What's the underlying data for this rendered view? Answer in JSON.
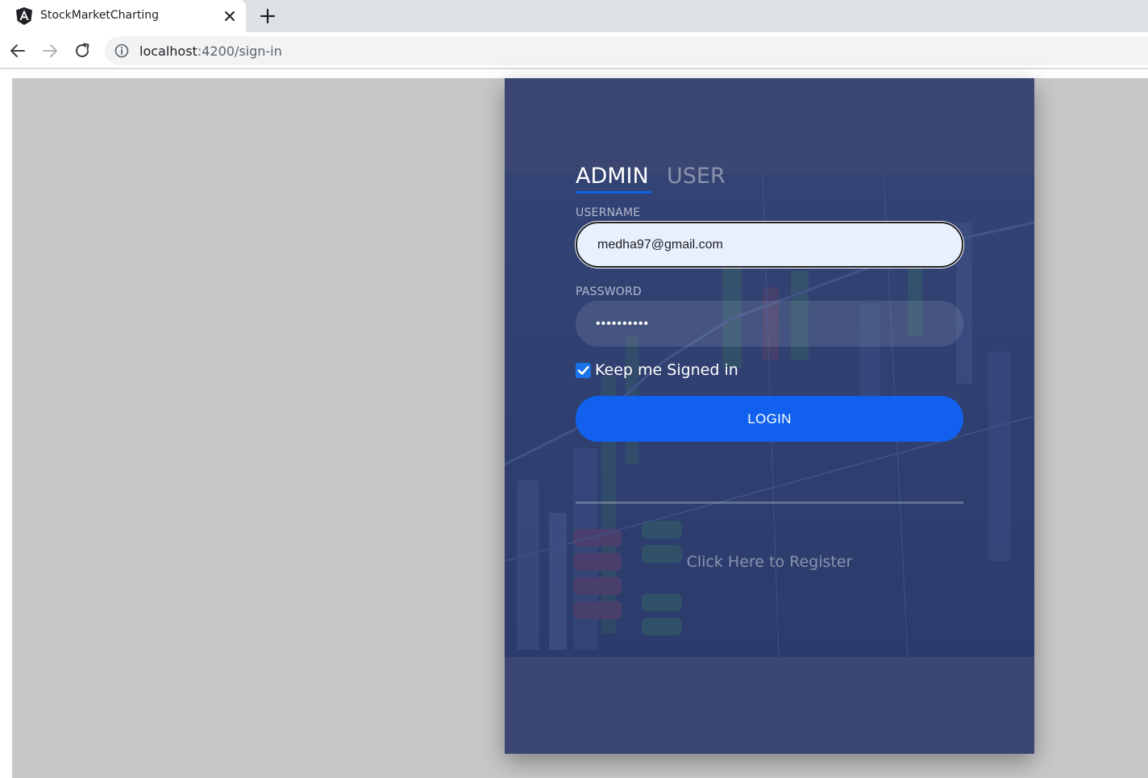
{
  "browser": {
    "tab_title": "StockMarketCharting",
    "url_host": "localhost",
    "url_path": ":4200/sign-in"
  },
  "login": {
    "tabs": [
      {
        "label": "ADMIN",
        "active": true
      },
      {
        "label": "USER",
        "active": false
      }
    ],
    "username_label": "USERNAME",
    "username_value": "medha97@gmail.com",
    "password_label": "PASSWORD",
    "password_value": "••••••••••",
    "keep_signed_in_label": "Keep me Signed in",
    "keep_signed_in_checked": true,
    "login_button": "LOGIN",
    "register_link": "Click Here to Register"
  },
  "colors": {
    "card_bg": "#3b4772",
    "accent": "#1161ee",
    "page_bg": "#c8c8c8"
  }
}
